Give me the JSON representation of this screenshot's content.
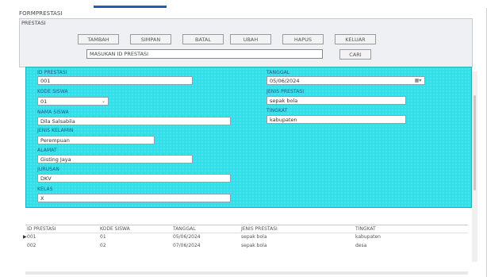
{
  "window": {
    "form_title": "FORMPRESTASI",
    "group_title": "PRESTASI"
  },
  "toolbar": {
    "buttons": [
      {
        "label": "TAMBAH"
      },
      {
        "label": "SIMPAN"
      },
      {
        "label": "BATAL"
      },
      {
        "label": "UBAH"
      },
      {
        "label": "HAPUS"
      },
      {
        "label": "KELUAR"
      }
    ],
    "search_value": "MASUKAN ID PRESTASI",
    "search_button": "CARI"
  },
  "form": {
    "id_prestasi": {
      "label": "ID PRESTASI",
      "value": "001"
    },
    "kode_siswa": {
      "label": "KODE SISWA",
      "value": "01"
    },
    "nama_siswa": {
      "label": "NAMA SISWA",
      "value": "Dila Salsabila"
    },
    "jenis_kelamin": {
      "label": "JENIS KELAMIN",
      "value": "Perempuan"
    },
    "alamat": {
      "label": "ALAMAT",
      "value": "Gisting Jaya"
    },
    "jurusan": {
      "label": "JURUSAN",
      "value": "DKV"
    },
    "kelas": {
      "label": "KELAS",
      "value": "X"
    },
    "tanggal": {
      "label": "TANGGAL",
      "value": "05/06/2024"
    },
    "jenis_prestasi": {
      "label": "JENIS PRESTASI",
      "value": "sepak bola"
    },
    "tingkat": {
      "label": "TINGKAT",
      "value": "kabupaten"
    }
  },
  "grid": {
    "columns": [
      "ID PRESTASI",
      "KODE SISWA",
      "TANGGAL",
      "JENIS PRESTASI",
      "TINGKAT"
    ],
    "rows": [
      {
        "marker": "▶",
        "cells": [
          "001",
          "01",
          "05/06/2024",
          "sepak bola",
          "kabupaten"
        ]
      },
      {
        "marker": "",
        "cells": [
          "002",
          "02",
          "07/06/2024",
          "sepak bola",
          "desa"
        ]
      }
    ]
  },
  "icons": {
    "dropdown": "chevron-down-icon",
    "calendar": "calendar-icon",
    "current_row": "row-pointer-icon"
  },
  "colors": {
    "form_background": "#33dfe8",
    "label_text": "#1e5a8a",
    "accent": "#1f5fb0"
  }
}
